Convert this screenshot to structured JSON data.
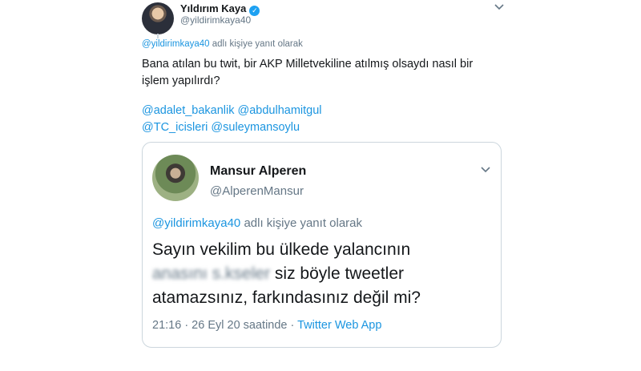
{
  "tweet": {
    "author_name": "Yıldırım Kaya",
    "author_handle": "@yildirimkaya40",
    "reply_to_handle": "@yildirimkaya40",
    "reply_suffix": "adlı kişiye yanıt olarak",
    "text_line1": "Bana atılan bu twit, bir AKP Milletvekiline atılmış olsaydı nasıl bir",
    "text_line2": "işlem yapılırdı?",
    "mentions_line1": "@adalet_bakanlik @abdulhamitgul",
    "mentions_line2": "@TC_icisleri @suleymansoylu"
  },
  "quoted": {
    "author_name": "Mansur Alperen",
    "author_handle": "@AlperenMansur",
    "reply_to_handle": "@yildirimkaya40",
    "reply_suffix": "adlı kişiye yanıt olarak",
    "text_line1": "Sayın vekilim bu ülkede yalancının",
    "blurred_text": "anasını s.kseler",
    "text_line2_rest": "siz böyle tweetler",
    "text_line3": "atamazsınız, farkındasınız değil mi?",
    "time": "21:16 · 26 Eyl 20 saatinde ·",
    "source": "Twitter Web App"
  },
  "icons": {
    "verified": "verified-badge-icon",
    "menu": "chevron-down-icon"
  },
  "colors": {
    "link": "#1b95e0",
    "secondary_text": "#657786",
    "primary_text": "#14171a",
    "verified": "#1da1f2"
  }
}
